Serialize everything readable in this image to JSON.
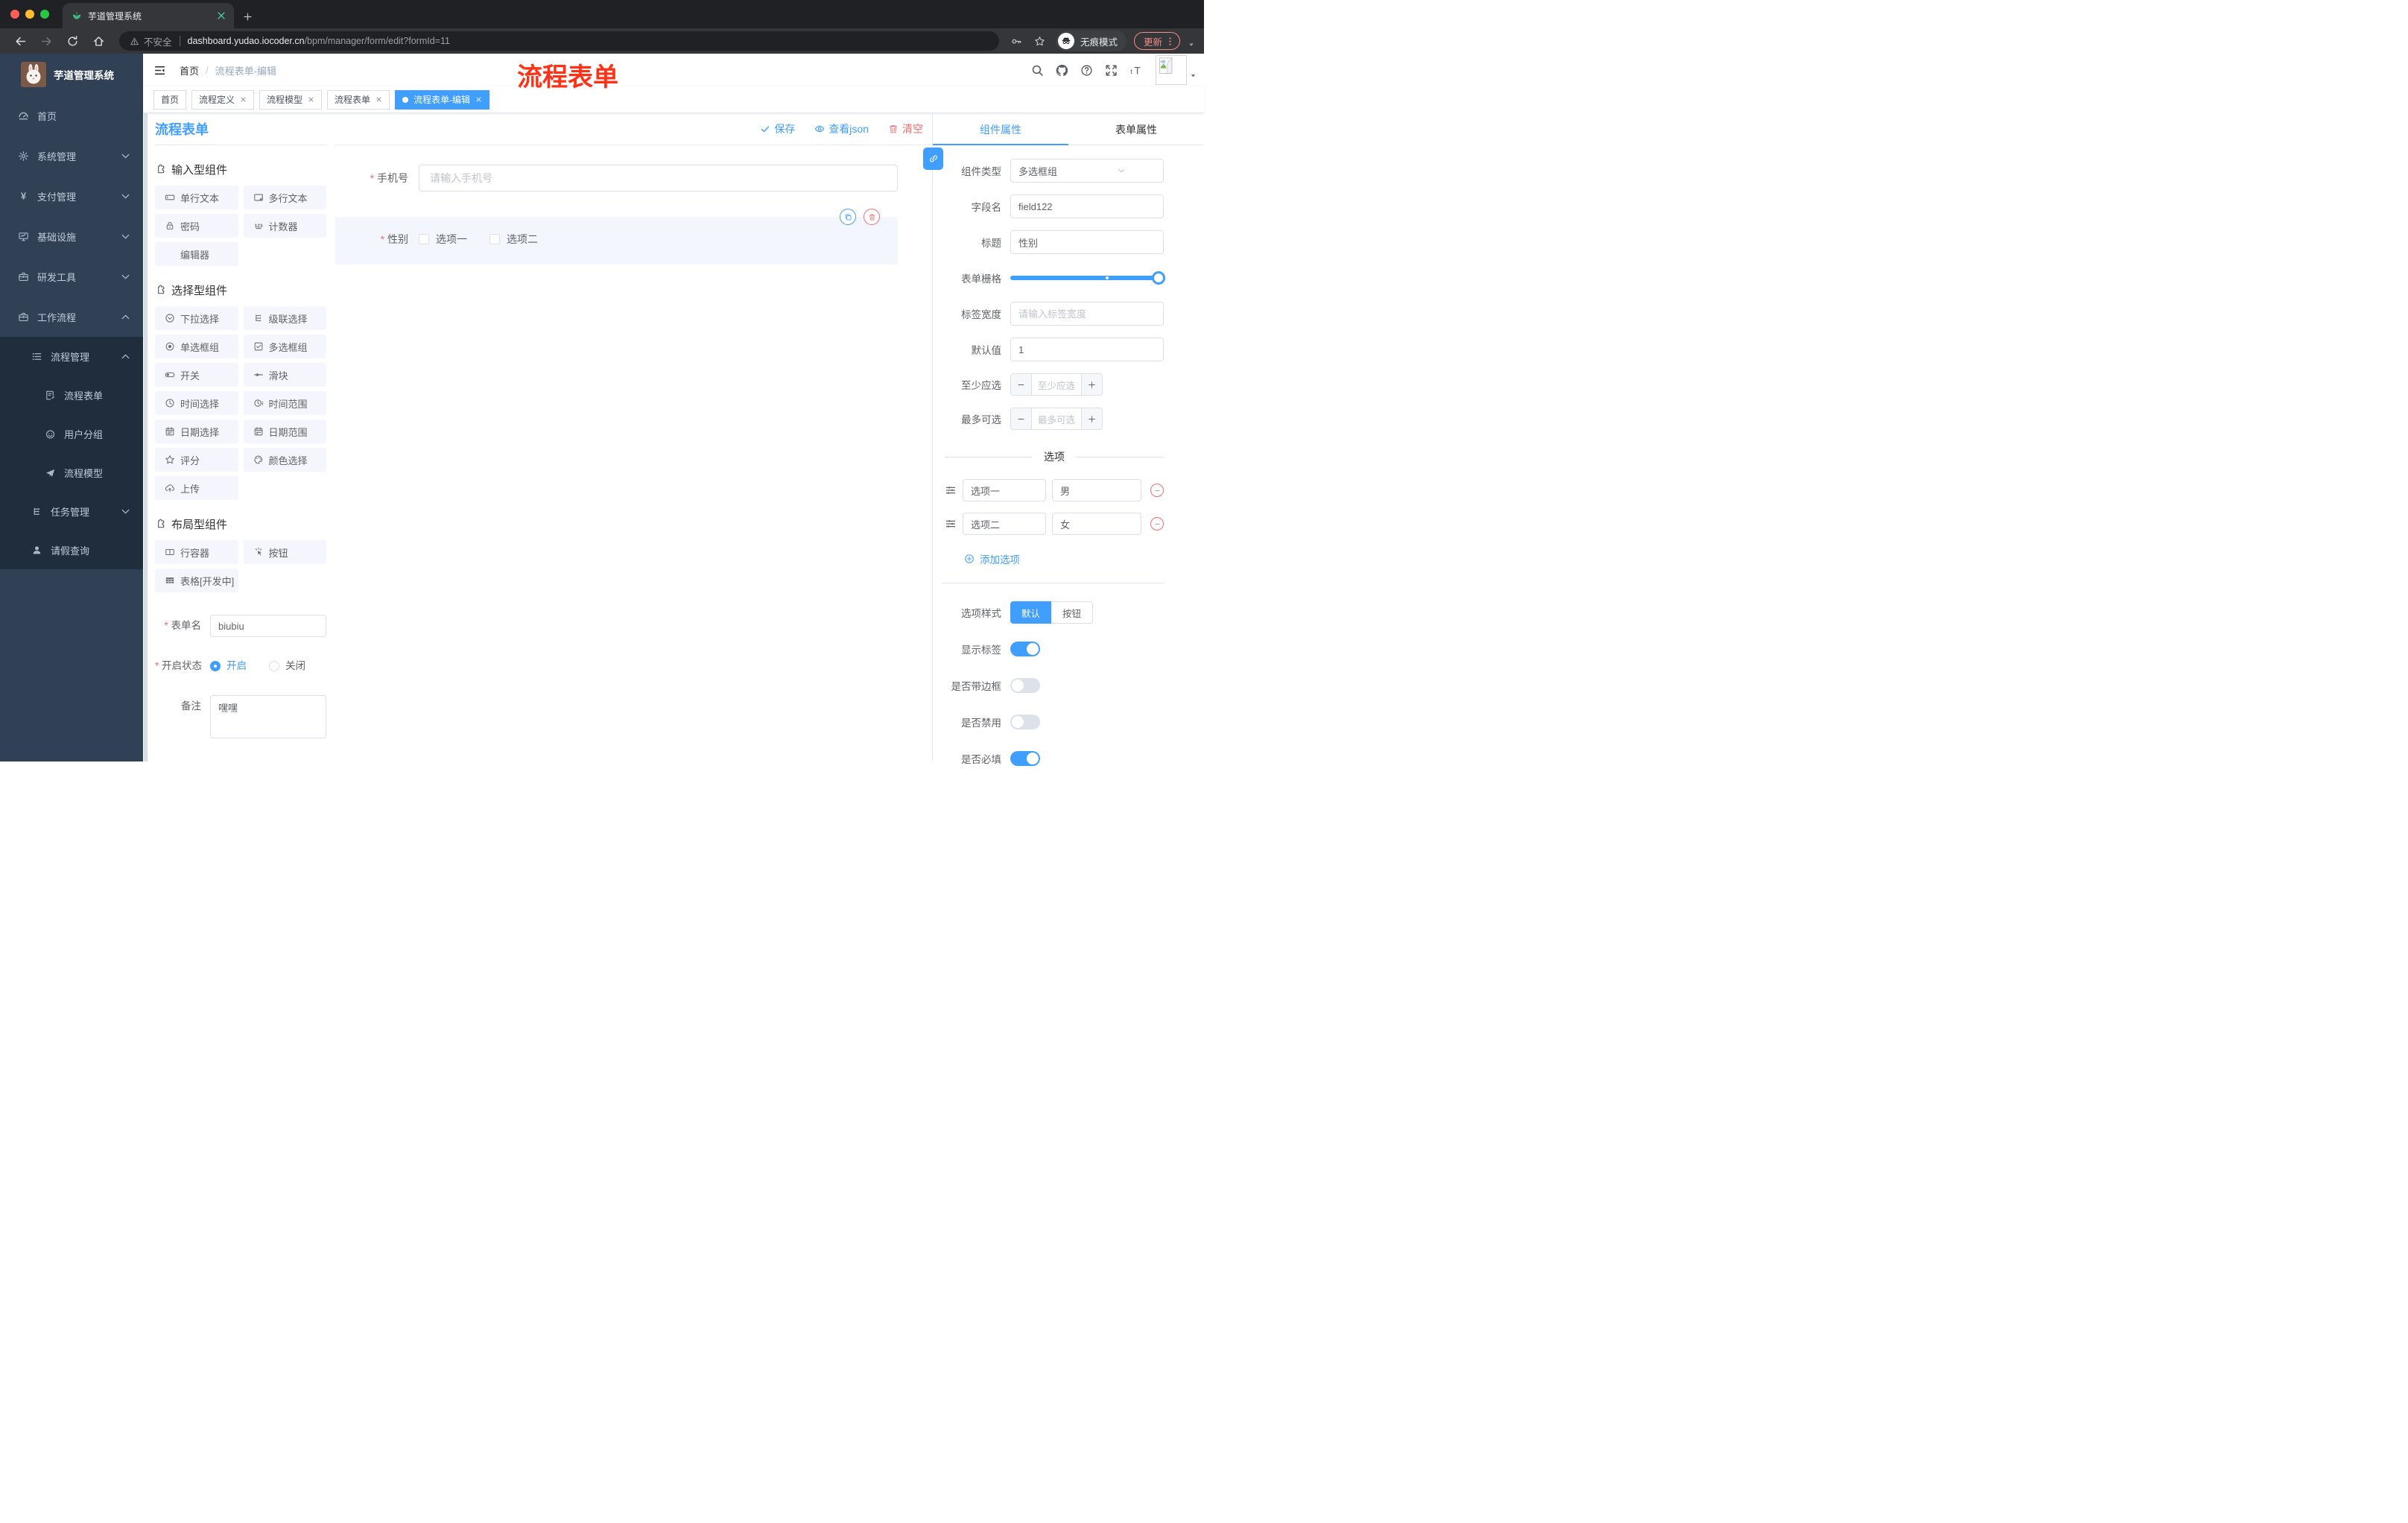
{
  "browser": {
    "tab_title": "芋道管理系统",
    "secure_label": "不安全",
    "url_host": "dashboard.yudao.iocoder.cn",
    "url_path": "/bpm/manager/form/edit?formId=11",
    "incognito_label": "无痕模式",
    "update_label": "更新"
  },
  "sidebar": {
    "app_title": "芋道管理系统",
    "items": [
      {
        "label": "首页",
        "icon": "dashboard"
      },
      {
        "label": "系统管理",
        "icon": "gear"
      },
      {
        "label": "支付管理",
        "icon": "yen"
      },
      {
        "label": "基础设施",
        "icon": "monitor"
      },
      {
        "label": "研发工具",
        "icon": "briefcase"
      },
      {
        "label": "工作流程",
        "icon": "briefcase",
        "expanded": true
      }
    ],
    "submenu": [
      {
        "label": "流程管理",
        "icon": "list",
        "expanded": true
      },
      {
        "label": "流程表单",
        "icon": "doc-edit"
      },
      {
        "label": "用户分组",
        "icon": "robot-face"
      },
      {
        "label": "流程模型",
        "icon": "paper-plane"
      },
      {
        "label": "任务管理",
        "icon": "tree"
      },
      {
        "label": "请假查询",
        "icon": "user"
      }
    ]
  },
  "header": {
    "breadcrumb_home": "首页",
    "breadcrumb_sep": "/",
    "breadcrumb_current": "流程表单-编辑",
    "watermark": "流程表单"
  },
  "tags": [
    {
      "label": "首页",
      "closable": false,
      "active": false
    },
    {
      "label": "流程定义",
      "closable": true,
      "active": false
    },
    {
      "label": "流程模型",
      "closable": true,
      "active": false
    },
    {
      "label": "流程表单",
      "closable": true,
      "active": false
    },
    {
      "label": "流程表单-编辑",
      "closable": true,
      "active": true
    }
  ],
  "palette": {
    "title": "流程表单",
    "sections": [
      {
        "title": "输入型组件",
        "items": [
          {
            "label": "单行文本",
            "icon": "input-box"
          },
          {
            "label": "多行文本",
            "icon": "textarea-box"
          },
          {
            "label": "密码",
            "icon": "lock"
          },
          {
            "label": "计数器",
            "icon": "counter"
          },
          {
            "label": "编辑器",
            "icon": ""
          }
        ]
      },
      {
        "title": "选择型组件",
        "items": [
          {
            "label": "下拉选择",
            "icon": "select-circle"
          },
          {
            "label": "级联选择",
            "icon": "cascade"
          },
          {
            "label": "单选框组",
            "icon": "radio-dot"
          },
          {
            "label": "多选框组",
            "icon": "checkbox"
          },
          {
            "label": "开关",
            "icon": "switch"
          },
          {
            "label": "滑块",
            "icon": "slider-dot"
          },
          {
            "label": "时间选择",
            "icon": "clock"
          },
          {
            "label": "时间范围",
            "icon": "clock-range"
          },
          {
            "label": "日期选择",
            "icon": "calendar"
          },
          {
            "label": "日期范围",
            "icon": "calendar-range"
          },
          {
            "label": "评分",
            "icon": "star"
          },
          {
            "label": "颜色选择",
            "icon": "palette-color"
          },
          {
            "label": "上传",
            "icon": "cloud-up"
          }
        ]
      },
      {
        "title": "布局型组件",
        "items": [
          {
            "label": "行容器",
            "icon": "row-split"
          },
          {
            "label": "按钮",
            "icon": "click-hand"
          },
          {
            "label": "表格[开发中]",
            "icon": "table-grid"
          }
        ]
      }
    ],
    "form": {
      "name_label": "表单名",
      "name_value": "biubiu",
      "status_label": "开启状态",
      "status_on": "开启",
      "status_off": "关闭",
      "status_on_selected": true,
      "remark_label": "备注",
      "remark_value": "嘿嘿"
    }
  },
  "canvas": {
    "save_label": "保存",
    "view_json_label": "查看json",
    "clear_label": "清空",
    "phone": {
      "label": "手机号",
      "placeholder": "请输入手机号"
    },
    "gender": {
      "label": "性别",
      "option1": "选项一",
      "option2": "选项二"
    }
  },
  "panel": {
    "tab_component": "组件属性",
    "tab_form": "表单属性",
    "type_label": "组件类型",
    "type_value": "多选框组",
    "field_label": "字段名",
    "field_value": "field122",
    "title_label": "标题",
    "title_value": "性别",
    "grid_label": "表单栅格",
    "width_label": "标签宽度",
    "width_placeholder": "请输入标签宽度",
    "default_label": "默认值",
    "default_value": "1",
    "min_label": "至少应选",
    "min_placeholder": "至少应选",
    "max_label": "最多可选",
    "max_placeholder": "最多可选",
    "options_title": "选项",
    "options": [
      {
        "name": "选项一",
        "value": "男"
      },
      {
        "name": "选项二",
        "value": "女"
      }
    ],
    "add_option_label": "添加选项",
    "style_label": "选项样式",
    "style_default": "默认",
    "style_button": "按钮",
    "toggles": [
      {
        "label": "显示标签",
        "on": true
      },
      {
        "label": "是否带边框",
        "on": false
      },
      {
        "label": "是否禁用",
        "on": false
      },
      {
        "label": "是否必填",
        "on": true
      }
    ]
  },
  "colors": {
    "accent": "#409eff",
    "danger": "#f56c6c",
    "watermark": "#fe3016",
    "sidebar_bg": "#304156",
    "submenu_bg": "#1f2d3d",
    "active_tag": "#409eff"
  }
}
